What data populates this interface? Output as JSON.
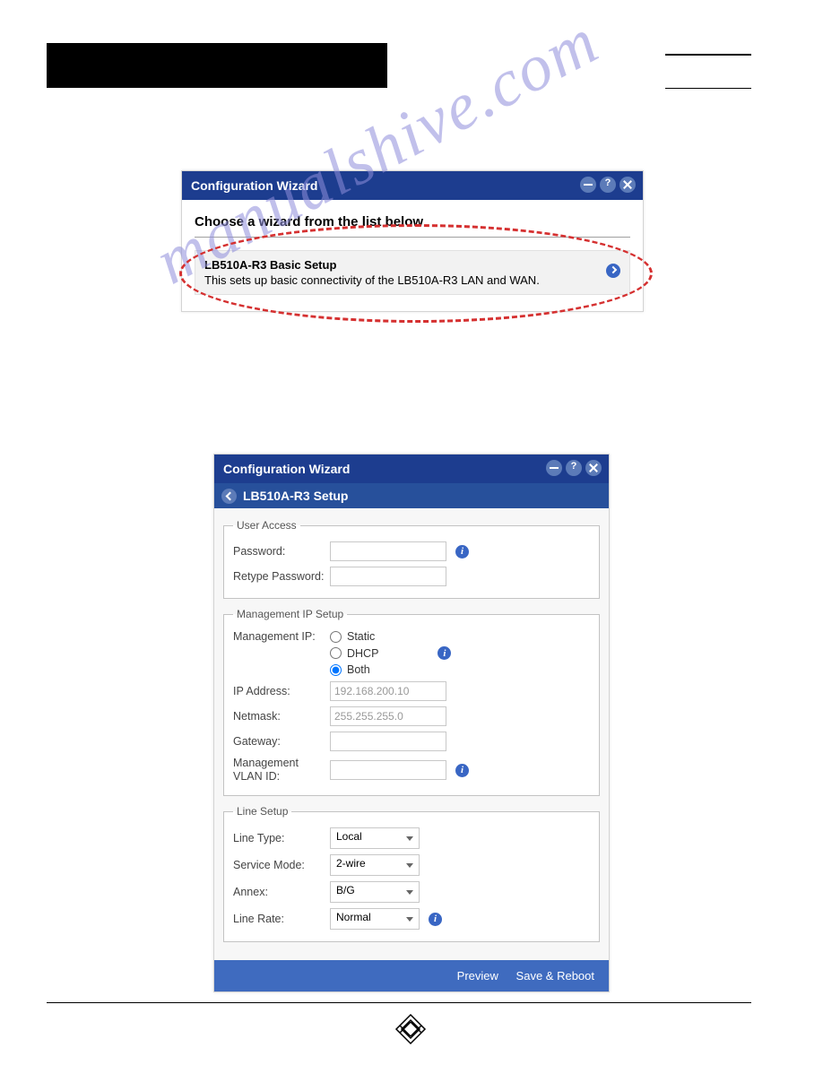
{
  "watermark": "manualshive.com",
  "dlg1": {
    "title": "Configuration Wizard",
    "choose": "Choose a wizard from the list below",
    "item": {
      "heading": "LB510A-R3 Basic Setup",
      "desc": "This sets up basic connectivity of the LB510A-R3 LAN and WAN."
    }
  },
  "dlg2": {
    "title": "Configuration Wizard",
    "subtitle": "LB510A-R3 Setup",
    "user_access": {
      "legend": "User Access",
      "pw_label": "Password:",
      "retype_label": "Retype Password:"
    },
    "mgmt": {
      "legend": "Management IP Setup",
      "mip_label": "Management IP:",
      "opt_static": "Static",
      "opt_dhcp": "DHCP",
      "opt_both": "Both",
      "ip_label": "IP Address:",
      "ip_value": "192.168.200.10",
      "netmask_label": "Netmask:",
      "netmask_value": "255.255.255.0",
      "gateway_label": "Gateway:",
      "vlan_label": "Management VLAN ID:"
    },
    "line": {
      "legend": "Line Setup",
      "type_label": "Line Type:",
      "type_value": "Local",
      "svc_label": "Service Mode:",
      "svc_value": "2-wire",
      "annex_label": "Annex:",
      "annex_value": "B/G",
      "rate_label": "Line Rate:",
      "rate_value": "Normal"
    },
    "footer": {
      "preview": "Preview",
      "save": "Save & Reboot"
    }
  }
}
